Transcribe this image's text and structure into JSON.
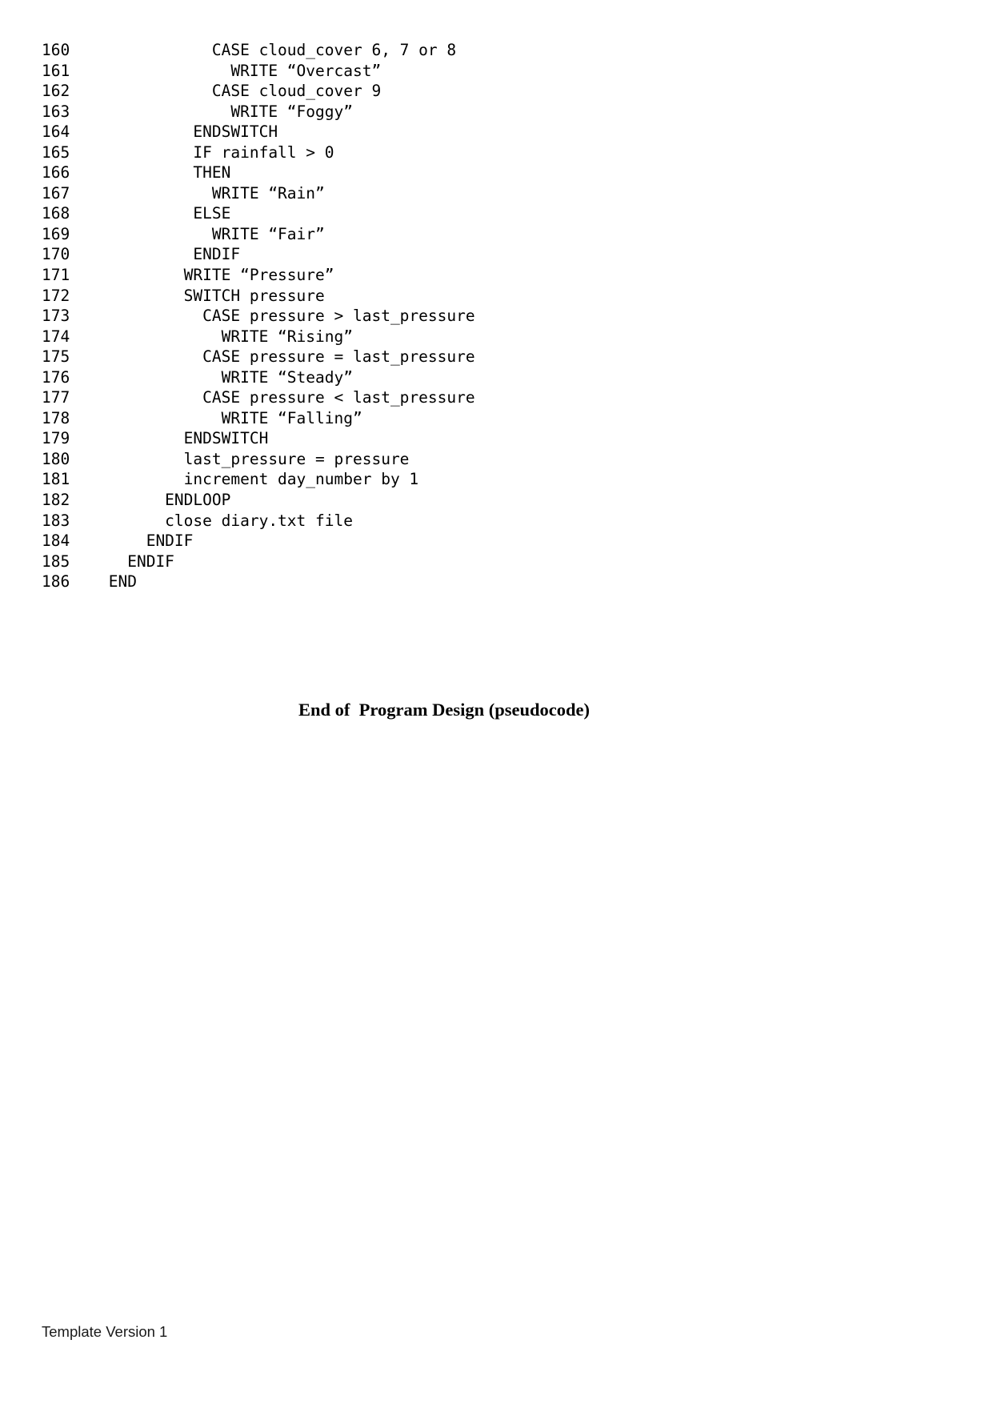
{
  "document": {
    "heading": "End of  Program Design (pseudocode)",
    "footer": "Template Version 1"
  },
  "code": {
    "lines": [
      {
        "number": "160",
        "text": "            CASE cloud_cover 6, 7 or 8"
      },
      {
        "number": "161",
        "text": "              WRITE “Overcast”"
      },
      {
        "number": "162",
        "text": "            CASE cloud_cover 9"
      },
      {
        "number": "163",
        "text": "              WRITE “Foggy”"
      },
      {
        "number": "164",
        "text": "          ENDSWITCH"
      },
      {
        "number": "165",
        "text": "          IF rainfall > 0"
      },
      {
        "number": "166",
        "text": "          THEN"
      },
      {
        "number": "167",
        "text": "            WRITE “Rain”"
      },
      {
        "number": "168",
        "text": "          ELSE"
      },
      {
        "number": "169",
        "text": "            WRITE “Fair”"
      },
      {
        "number": "170",
        "text": "          ENDIF"
      },
      {
        "number": "171",
        "text": "         WRITE “Pressure”"
      },
      {
        "number": "172",
        "text": "         SWITCH pressure"
      },
      {
        "number": "173",
        "text": "           CASE pressure > last_pressure"
      },
      {
        "number": "174",
        "text": "             WRITE “Rising”"
      },
      {
        "number": "175",
        "text": "           CASE pressure = last_pressure"
      },
      {
        "number": "176",
        "text": "             WRITE “Steady”"
      },
      {
        "number": "177",
        "text": "           CASE pressure < last_pressure"
      },
      {
        "number": "178",
        "text": "             WRITE “Falling”"
      },
      {
        "number": "179",
        "text": "         ENDSWITCH"
      },
      {
        "number": "180",
        "text": "         last_pressure = pressure"
      },
      {
        "number": "181",
        "text": "         increment day_number by 1"
      },
      {
        "number": "182",
        "text": "       ENDLOOP"
      },
      {
        "number": "183",
        "text": "       close diary.txt file"
      },
      {
        "number": "184",
        "text": "     ENDIF"
      },
      {
        "number": "185",
        "text": "   ENDIF"
      },
      {
        "number": "186",
        "text": " END"
      }
    ]
  }
}
